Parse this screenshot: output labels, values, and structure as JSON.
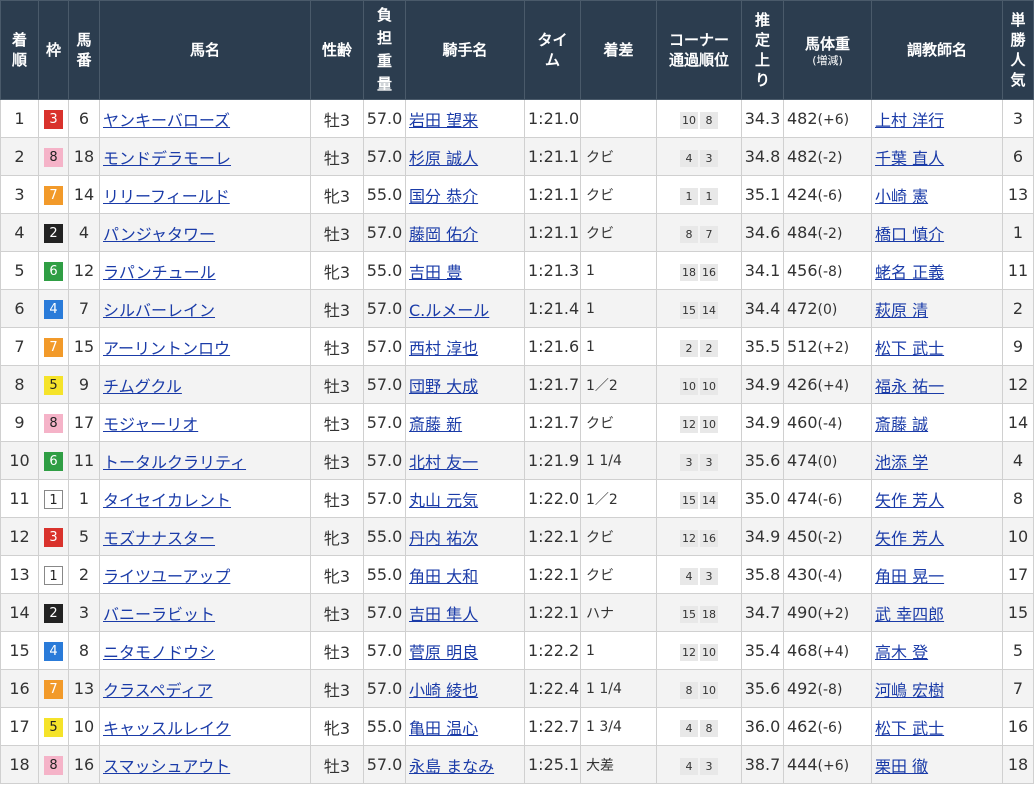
{
  "headers": {
    "rank": "着順",
    "waku": "枠",
    "umaban": "馬番",
    "horse": "馬名",
    "sexage": "性齢",
    "weight_carried": "負担重量",
    "jockey": "騎手名",
    "time": "タイム",
    "margin": "着差",
    "corner_line1": "コーナー",
    "corner_line2": "通過順位",
    "last3f": "推定上り",
    "body_weight": "馬体重",
    "body_weight_sub": "(増減)",
    "trainer": "調教師名",
    "popularity": "単勝人気"
  },
  "rows": [
    {
      "rank": "1",
      "waku": "3",
      "umaban": "6",
      "horse": "ヤンキーバローズ",
      "sexage": "牡3",
      "weight": "57.0",
      "jockey": "岩田 望来",
      "time": "1:21.0",
      "margin": "",
      "c1": "10",
      "c2": "8",
      "last3f": "34.3",
      "bw": "482",
      "bwdiff": "(+6)",
      "trainer": "上村 洋行",
      "pop": "3"
    },
    {
      "rank": "2",
      "waku": "8",
      "umaban": "18",
      "horse": "モンドデラモーレ",
      "sexage": "牡3",
      "weight": "57.0",
      "jockey": "杉原 誠人",
      "time": "1:21.1",
      "margin": "クビ",
      "c1": "4",
      "c2": "3",
      "last3f": "34.8",
      "bw": "482",
      "bwdiff": "(-2)",
      "trainer": "千葉 直人",
      "pop": "6"
    },
    {
      "rank": "3",
      "waku": "7",
      "umaban": "14",
      "horse": "リリーフィールド",
      "sexage": "牝3",
      "weight": "55.0",
      "jockey": "国分 恭介",
      "time": "1:21.1",
      "margin": "クビ",
      "c1": "1",
      "c2": "1",
      "last3f": "35.1",
      "bw": "424",
      "bwdiff": "(-6)",
      "trainer": "小崎 憲",
      "pop": "13"
    },
    {
      "rank": "4",
      "waku": "2",
      "umaban": "4",
      "horse": "パンジャタワー",
      "sexage": "牡3",
      "weight": "57.0",
      "jockey": "藤岡 佑介",
      "time": "1:21.1",
      "margin": "クビ",
      "c1": "8",
      "c2": "7",
      "last3f": "34.6",
      "bw": "484",
      "bwdiff": "(-2)",
      "trainer": "橋口 慎介",
      "pop": "1"
    },
    {
      "rank": "5",
      "waku": "6",
      "umaban": "12",
      "horse": "ラパンチュール",
      "sexage": "牝3",
      "weight": "55.0",
      "jockey": "吉田 豊",
      "time": "1:21.3",
      "margin": "1",
      "c1": "18",
      "c2": "16",
      "last3f": "34.1",
      "bw": "456",
      "bwdiff": "(-8)",
      "trainer": "蛯名 正義",
      "pop": "11"
    },
    {
      "rank": "6",
      "waku": "4",
      "umaban": "7",
      "horse": "シルバーレイン",
      "sexage": "牡3",
      "weight": "57.0",
      "jockey": "C.ルメール",
      "time": "1:21.4",
      "margin": "1",
      "c1": "15",
      "c2": "14",
      "last3f": "34.4",
      "bw": "472",
      "bwdiff": "(0)",
      "trainer": "萩原 清",
      "pop": "2"
    },
    {
      "rank": "7",
      "waku": "7",
      "umaban": "15",
      "horse": "アーリントンロウ",
      "sexage": "牡3",
      "weight": "57.0",
      "jockey": "西村 淳也",
      "time": "1:21.6",
      "margin": "1",
      "c1": "2",
      "c2": "2",
      "last3f": "35.5",
      "bw": "512",
      "bwdiff": "(+2)",
      "trainer": "松下 武士",
      "pop": "9"
    },
    {
      "rank": "8",
      "waku": "5",
      "umaban": "9",
      "horse": "チムグクル",
      "sexage": "牡3",
      "weight": "57.0",
      "jockey": "団野 大成",
      "time": "1:21.7",
      "margin": "1／2",
      "c1": "10",
      "c2": "10",
      "last3f": "34.9",
      "bw": "426",
      "bwdiff": "(+4)",
      "trainer": "福永 祐一",
      "pop": "12"
    },
    {
      "rank": "9",
      "waku": "8",
      "umaban": "17",
      "horse": "モジャーリオ",
      "sexage": "牡3",
      "weight": "57.0",
      "jockey": "斎藤 新",
      "time": "1:21.7",
      "margin": "クビ",
      "c1": "12",
      "c2": "10",
      "last3f": "34.9",
      "bw": "460",
      "bwdiff": "(-4)",
      "trainer": "斎藤 誠",
      "pop": "14"
    },
    {
      "rank": "10",
      "waku": "6",
      "umaban": "11",
      "horse": "トータルクラリティ",
      "sexage": "牡3",
      "weight": "57.0",
      "jockey": "北村 友一",
      "time": "1:21.9",
      "margin": "1 1/4",
      "c1": "3",
      "c2": "3",
      "last3f": "35.6",
      "bw": "474",
      "bwdiff": "(0)",
      "trainer": "池添 学",
      "pop": "4"
    },
    {
      "rank": "11",
      "waku": "1",
      "umaban": "1",
      "horse": "タイセイカレント",
      "sexage": "牡3",
      "weight": "57.0",
      "jockey": "丸山 元気",
      "time": "1:22.0",
      "margin": "1／2",
      "c1": "15",
      "c2": "14",
      "last3f": "35.0",
      "bw": "474",
      "bwdiff": "(-6)",
      "trainer": "矢作 芳人",
      "pop": "8"
    },
    {
      "rank": "12",
      "waku": "3",
      "umaban": "5",
      "horse": "モズナナスター",
      "sexage": "牝3",
      "weight": "55.0",
      "jockey": "丹内 祐次",
      "time": "1:22.1",
      "margin": "クビ",
      "c1": "12",
      "c2": "16",
      "last3f": "34.9",
      "bw": "450",
      "bwdiff": "(-2)",
      "trainer": "矢作 芳人",
      "pop": "10"
    },
    {
      "rank": "13",
      "waku": "1",
      "umaban": "2",
      "horse": "ライツユーアップ",
      "sexage": "牝3",
      "weight": "55.0",
      "jockey": "角田 大和",
      "time": "1:22.1",
      "margin": "クビ",
      "c1": "4",
      "c2": "3",
      "last3f": "35.8",
      "bw": "430",
      "bwdiff": "(-4)",
      "trainer": "角田 晃一",
      "pop": "17"
    },
    {
      "rank": "14",
      "waku": "2",
      "umaban": "3",
      "horse": "バニーラビット",
      "sexage": "牡3",
      "weight": "57.0",
      "jockey": "吉田 隼人",
      "time": "1:22.1",
      "margin": "ハナ",
      "c1": "15",
      "c2": "18",
      "last3f": "34.7",
      "bw": "490",
      "bwdiff": "(+2)",
      "trainer": "武 幸四郎",
      "pop": "15"
    },
    {
      "rank": "15",
      "waku": "4",
      "umaban": "8",
      "horse": "ニタモノドウシ",
      "sexage": "牡3",
      "weight": "57.0",
      "jockey": "菅原 明良",
      "time": "1:22.2",
      "margin": "1",
      "c1": "12",
      "c2": "10",
      "last3f": "35.4",
      "bw": "468",
      "bwdiff": "(+4)",
      "trainer": "高木 登",
      "pop": "5"
    },
    {
      "rank": "16",
      "waku": "7",
      "umaban": "13",
      "horse": "クラスペディア",
      "sexage": "牡3",
      "weight": "57.0",
      "jockey": "小崎 綾也",
      "time": "1:22.4",
      "margin": "1 1/4",
      "c1": "8",
      "c2": "10",
      "last3f": "35.6",
      "bw": "492",
      "bwdiff": "(-8)",
      "trainer": "河嶋 宏樹",
      "pop": "7"
    },
    {
      "rank": "17",
      "waku": "5",
      "umaban": "10",
      "horse": "キャッスルレイク",
      "sexage": "牝3",
      "weight": "55.0",
      "jockey": "亀田 温心",
      "time": "1:22.7",
      "margin": "1 3/4",
      "c1": "4",
      "c2": "8",
      "last3f": "36.0",
      "bw": "462",
      "bwdiff": "(-6)",
      "trainer": "松下 武士",
      "pop": "16"
    },
    {
      "rank": "18",
      "waku": "8",
      "umaban": "16",
      "horse": "スマッシュアウト",
      "sexage": "牡3",
      "weight": "57.0",
      "jockey": "永島 まなみ",
      "time": "1:25.1",
      "margin": "大差",
      "c1": "4",
      "c2": "3",
      "last3f": "38.7",
      "bw": "444",
      "bwdiff": "(+6)",
      "trainer": "栗田 徹",
      "pop": "18"
    }
  ]
}
